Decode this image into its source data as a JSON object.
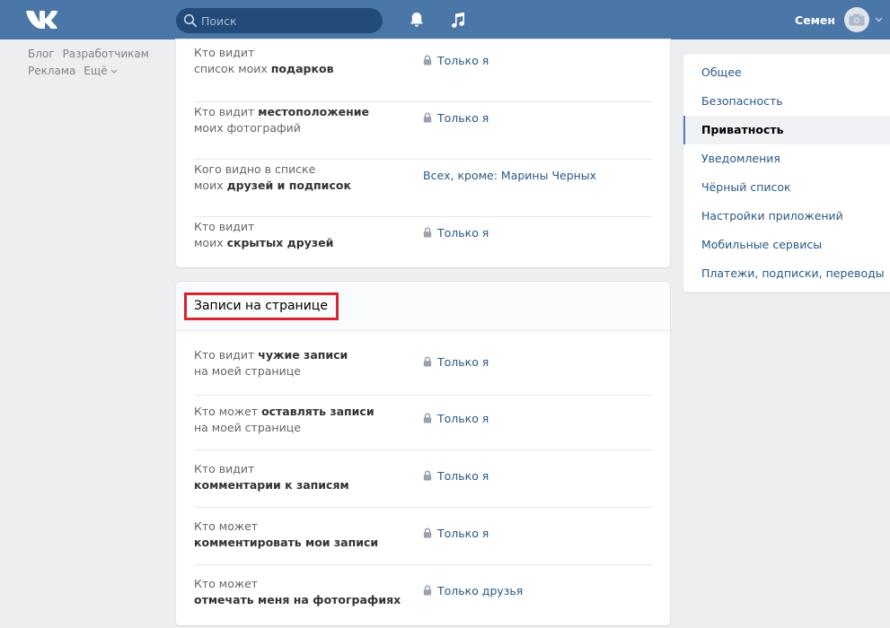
{
  "header": {
    "search_placeholder": "Поиск",
    "user_name": "Семен",
    "accent_color": "#4a76a8"
  },
  "left_links": {
    "row1": [
      "Блог",
      "Разработчикам"
    ],
    "row2": [
      "Реклама",
      "Ещё"
    ]
  },
  "card1": {
    "rows": [
      {
        "line1": "Кто видит",
        "line2_plain": "список моих ",
        "line2_bold": "подарков",
        "line1_bold": "",
        "value": "Только я",
        "lock": true
      },
      {
        "line1": "Кто видит ",
        "line1_bold": "местоположение",
        "line2_plain": "моих фотографий",
        "line2_bold": "",
        "value": "Только я",
        "lock": true
      },
      {
        "line1": "Кого видно в списке",
        "line1_bold": "",
        "line2_plain": "моих ",
        "line2_bold": "друзей и подписок",
        "value": "Всех, кроме: Марины Черных",
        "lock": false
      },
      {
        "line1": "Кто видит",
        "line1_bold": "",
        "line2_plain": "моих ",
        "line2_bold": "скрытых друзей",
        "value": "Только я",
        "lock": true
      }
    ]
  },
  "card2": {
    "title": "Записи на странице",
    "rows": [
      {
        "line1": "Кто видит ",
        "line1_bold": "чужие записи",
        "line2_plain": "на моей странице",
        "line2_bold": "",
        "value": "Только я",
        "lock": true
      },
      {
        "line1": "Кто может ",
        "line1_bold": "оставлять записи",
        "line2_plain": "на моей странице",
        "line2_bold": "",
        "value": "Только я",
        "lock": true
      },
      {
        "line1": "Кто видит",
        "line1_bold": "",
        "line2_plain": "",
        "line2_bold": "комментарии к записям",
        "value": "Только я",
        "lock": true
      },
      {
        "line1": "Кто может",
        "line1_bold": "",
        "line2_plain": "",
        "line2_bold": "комментировать мои записи",
        "value": "Только я",
        "lock": true
      },
      {
        "line1": "Кто может",
        "line1_bold": "",
        "line2_plain": "",
        "line2_bold": "отмечать меня на фотографиях",
        "value": "Только друзья",
        "lock": true
      }
    ]
  },
  "right_nav": {
    "items": [
      "Общее",
      "Безопасность",
      "Приватность",
      "Уведомления",
      "Чёрный список",
      "Настройки приложений",
      "Мобильные сервисы",
      "Платежи, подписки, переводы"
    ],
    "active": "Приватность"
  },
  "icons": {
    "logo": "vk-logo",
    "search": "search-icon",
    "notifications": "bell-icon",
    "music": "music-icon",
    "avatar": "camera-icon",
    "menu": "chevron-down-icon",
    "value_prefix": "lock-icon"
  }
}
